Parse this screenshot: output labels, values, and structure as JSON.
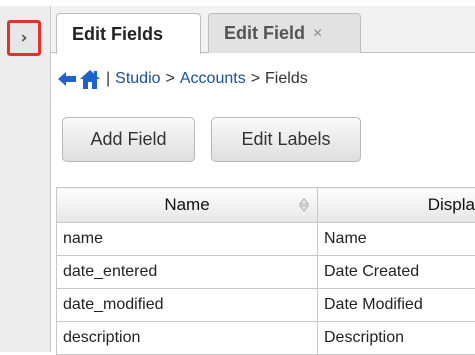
{
  "tabs": [
    {
      "label": "Edit Fields",
      "active": true
    },
    {
      "label": "Edit Field",
      "active": false,
      "close_glyph": "×"
    }
  ],
  "expand_button": {
    "glyph": "›",
    "icon": "chevron-right-icon"
  },
  "breadcrumb": {
    "back_icon": "back-arrow-icon",
    "home_icon": "home-icon",
    "separator_pipe": "|",
    "items": [
      "Studio",
      "Accounts",
      "Fields"
    ],
    "separator": ">"
  },
  "toolbar": {
    "add_field_label": "Add Field",
    "edit_labels_label": "Edit Labels"
  },
  "table": {
    "headers": {
      "name": "Name",
      "display": "Displa"
    },
    "rows": [
      {
        "name": "name",
        "display": "Name"
      },
      {
        "name": "date_entered",
        "display": "Date Created"
      },
      {
        "name": "date_modified",
        "display": "Date Modified"
      },
      {
        "name": "description",
        "display": "Description"
      }
    ]
  },
  "colors": {
    "highlight_border": "#e4322b",
    "link": "#1a4f9e",
    "icon_blue": "#1d63c9"
  }
}
